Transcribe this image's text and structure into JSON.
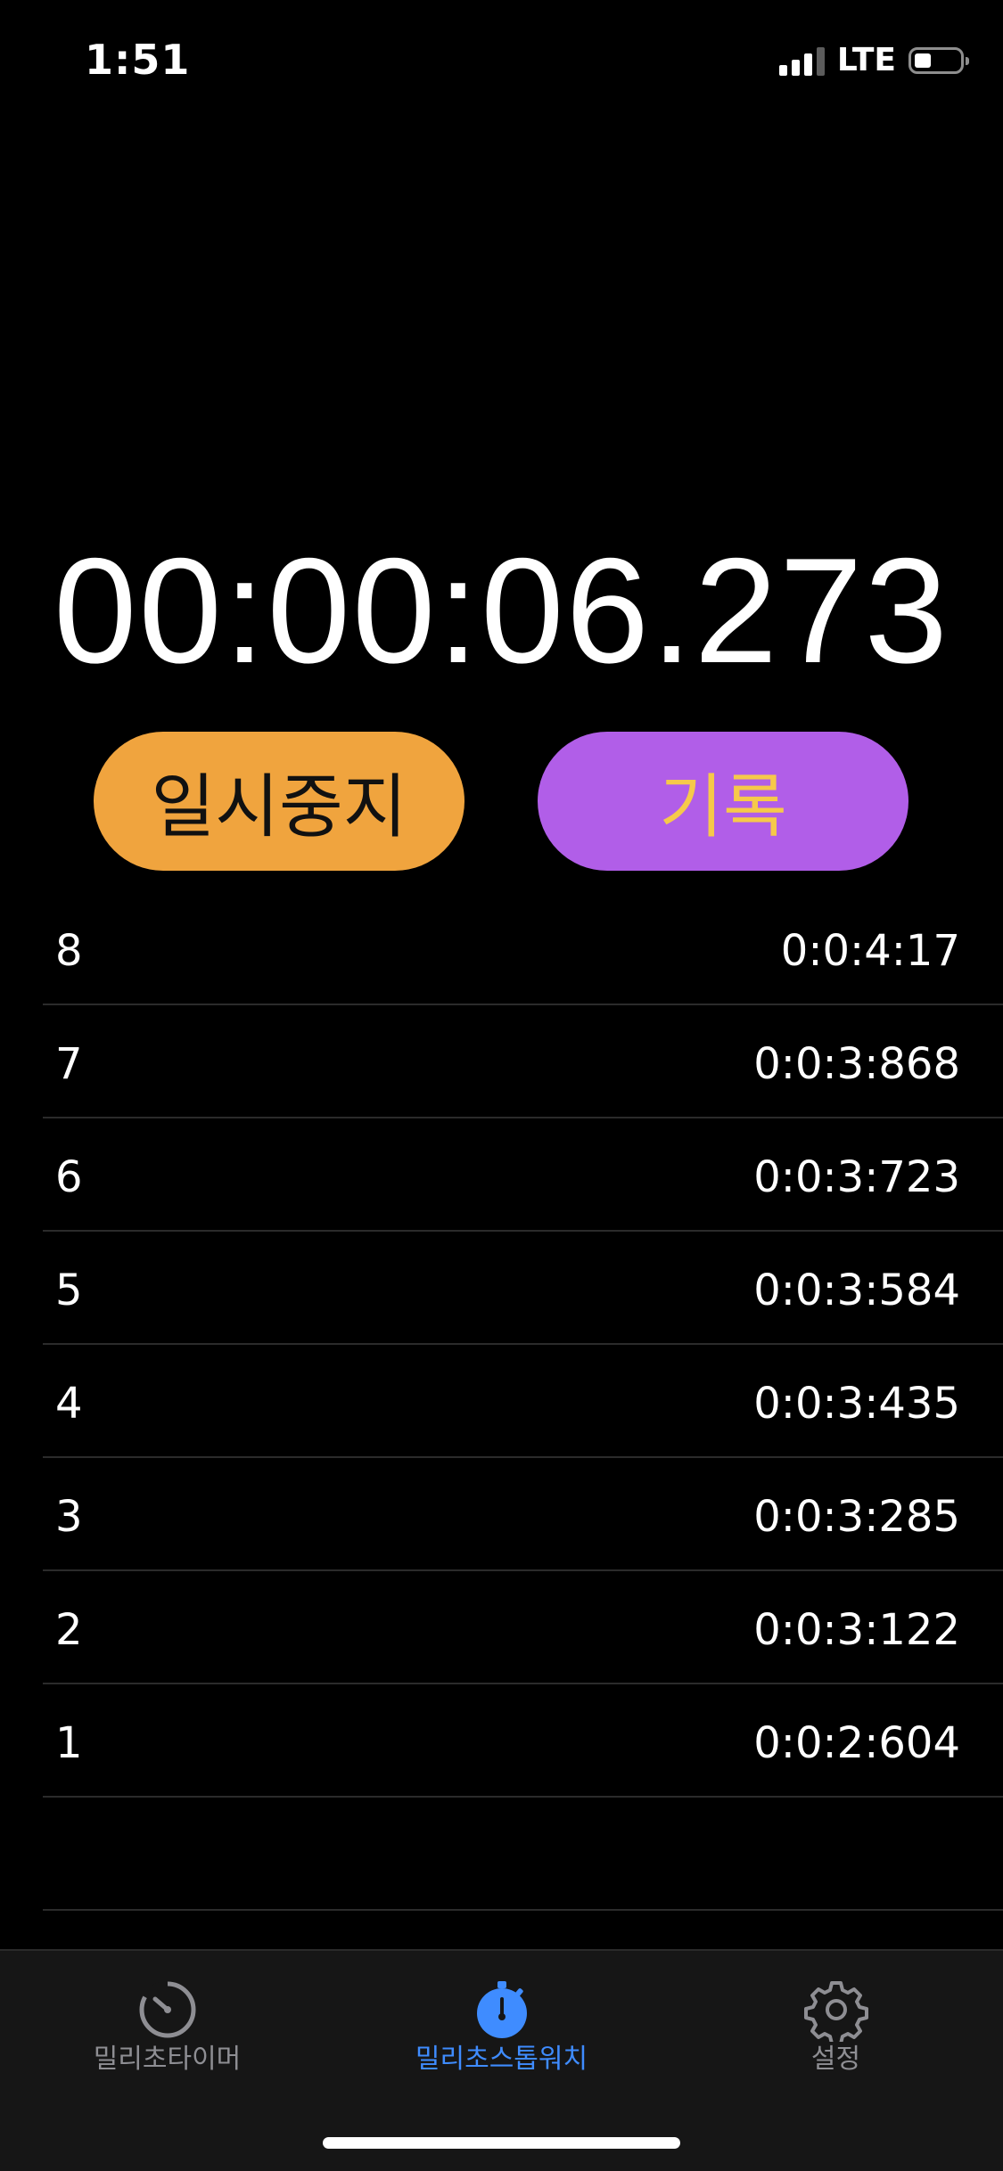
{
  "status_bar": {
    "time": "1:51",
    "network": "LTE",
    "battery_level": 0.3
  },
  "timer": {
    "display": "00:00:06.273"
  },
  "buttons": {
    "pause_label": "일시중지",
    "lap_label": "기록"
  },
  "laps": [
    {
      "number": "8",
      "time": "0:0:4:17"
    },
    {
      "number": "7",
      "time": "0:0:3:868"
    },
    {
      "number": "6",
      "time": "0:0:3:723"
    },
    {
      "number": "5",
      "time": "0:0:3:584"
    },
    {
      "number": "4",
      "time": "0:0:3:435"
    },
    {
      "number": "3",
      "time": "0:0:3:285"
    },
    {
      "number": "2",
      "time": "0:0:3:122"
    },
    {
      "number": "1",
      "time": "0:0:2:604"
    }
  ],
  "tab_bar": {
    "tabs": [
      {
        "label": "밀리초타이머",
        "icon": "timer-gauge-icon",
        "active": false
      },
      {
        "label": "밀리초스톱워치",
        "icon": "stopwatch-icon",
        "active": true
      },
      {
        "label": "설정",
        "icon": "gear-icon",
        "active": false
      }
    ]
  },
  "colors": {
    "pause_button": "#f0a43e",
    "lap_button": "#b15ee8",
    "lap_text": "#f6c94a",
    "active_tab": "#3f8cff",
    "inactive_tab": "#8e8e93"
  }
}
